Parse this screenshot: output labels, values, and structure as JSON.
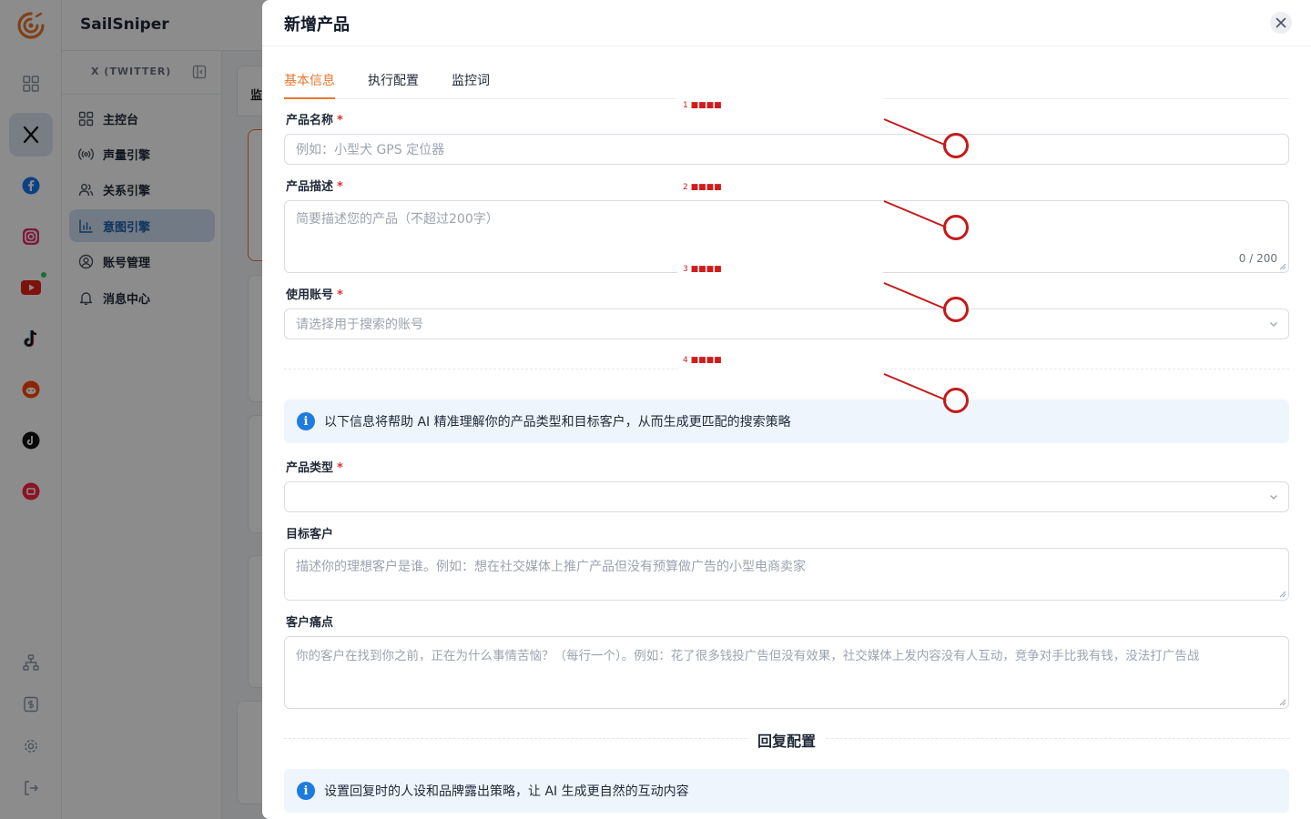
{
  "app": {
    "brand": "SailSniper",
    "platforms": [
      {
        "name": "dashboard-icon"
      },
      {
        "name": "x-twitter-icon"
      },
      {
        "name": "facebook-icon"
      },
      {
        "name": "instagram-icon"
      },
      {
        "name": "youtube-icon"
      },
      {
        "name": "tiktok-icon"
      },
      {
        "name": "reddit-icon"
      },
      {
        "name": "threads-icon"
      },
      {
        "name": "xiaohongshu-icon"
      }
    ],
    "subnav": {
      "title": "X (TWITTER)",
      "items": [
        {
          "label": "主控台",
          "icon": "grid-icon"
        },
        {
          "label": "声量引擎",
          "icon": "broadcast-icon"
        },
        {
          "label": "关系引擎",
          "icon": "users-icon"
        },
        {
          "label": "意图引擎",
          "icon": "bar-chart-icon",
          "active": true
        },
        {
          "label": "账号管理",
          "icon": "user-circle-icon"
        },
        {
          "label": "消息中心",
          "icon": "bell-icon"
        }
      ]
    },
    "peek_text": "监"
  },
  "drawer": {
    "title": "新增产品",
    "tabs": [
      {
        "label": "基本信息",
        "active": true
      },
      {
        "label": "执行配置"
      },
      {
        "label": "监控词"
      }
    ],
    "fields": {
      "product_name": {
        "label": "产品名称",
        "required": "*",
        "placeholder": "例如：小型犬 GPS 定位器"
      },
      "product_desc": {
        "label": "产品描述",
        "required": "*",
        "placeholder": "简要描述您的产品（不超过200字）",
        "counter": "0 / 200"
      },
      "account": {
        "label": "使用账号",
        "required": "*",
        "placeholder": "请选择用于搜索的账号"
      },
      "product_type": {
        "label": "产品类型",
        "required": "*",
        "placeholder": ""
      },
      "target_customer": {
        "label": "目标客户",
        "placeholder": "描述你的理想客户是谁。例如：想在社交媒体上推广产品但没有预算做广告的小型电商卖家"
      },
      "pain_points": {
        "label": "客户痛点",
        "placeholder": "你的客户在找到你之前，正在为什么事情苦恼？（每行一个）。例如：花了很多钱投广告但没有效果，社交媒体上发内容没有人互动，竞争对手比我有钱，没法打广告战"
      }
    },
    "info_ai": "以下信息将帮助 AI 精准理解你的产品类型和目标客户，从而生成更匹配的搜索策略",
    "reply_section": "回复配置",
    "info_reply": "设置回复时的人设和品牌露出策略，让 AI 生成更自然的互动内容"
  },
  "annotations": [
    "1 ■■■■",
    "2 ■■■■",
    "3 ■■■■",
    "4 ■■■■"
  ],
  "colors": {
    "accent": "#e8772e",
    "primary": "#1e7be0",
    "required": "#e03131",
    "annotation": "#c41a1a"
  }
}
